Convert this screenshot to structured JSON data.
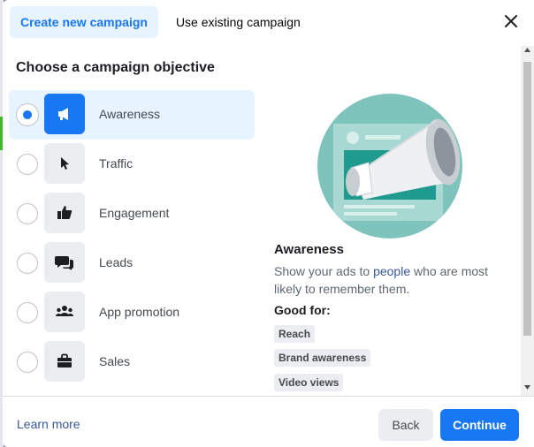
{
  "tabs": [
    {
      "label": "Create new campaign",
      "active": true
    },
    {
      "label": "Use existing campaign",
      "active": false
    }
  ],
  "heading": "Choose a campaign objective",
  "objectives": [
    {
      "label": "Awareness",
      "icon": "megaphone-icon",
      "selected": true
    },
    {
      "label": "Traffic",
      "icon": "cursor-icon",
      "selected": false
    },
    {
      "label": "Engagement",
      "icon": "thumbs-up-icon",
      "selected": false
    },
    {
      "label": "Leads",
      "icon": "chat-bubbles-icon",
      "selected": false
    },
    {
      "label": "App promotion",
      "icon": "people-group-icon",
      "selected": false
    },
    {
      "label": "Sales",
      "icon": "shopping-bag-icon",
      "selected": false
    }
  ],
  "detail": {
    "title": "Awareness",
    "desc_before": "Show your ads to ",
    "desc_link": "people",
    "desc_after": " who are most likely to remember them.",
    "good_for_label": "Good for:",
    "tags": [
      "Reach",
      "Brand awareness",
      "Video views"
    ]
  },
  "footer": {
    "learn_more": "Learn more",
    "back": "Back",
    "continue": "Continue"
  },
  "colors": {
    "accent": "#1877f2",
    "selected_bg": "#e7f3ff",
    "illustration_teal": "#7fc4bc"
  }
}
